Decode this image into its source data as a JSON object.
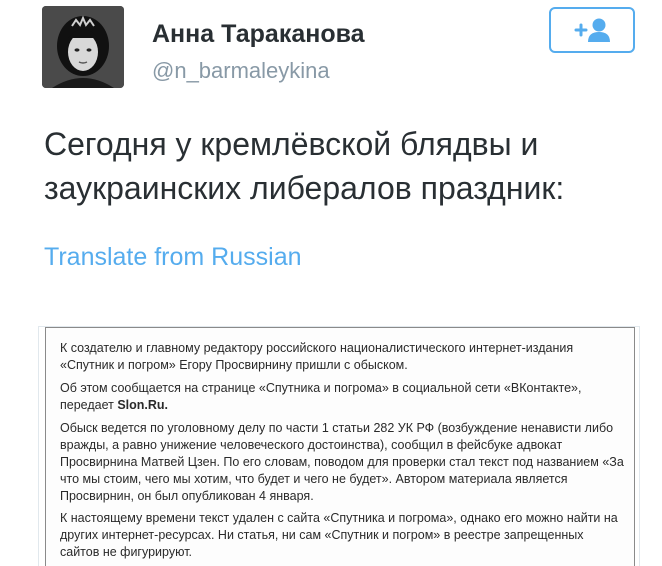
{
  "header": {
    "display_name": "Анна Тараканова",
    "handle": "@n_barmaleykina",
    "follow_icon": "add-user-icon"
  },
  "tweet": {
    "text": "Сегодня у кремлёвской блядвы и заукраинских либералов праздник:",
    "translate_label": "Translate from Russian"
  },
  "attached_image": {
    "paragraphs": [
      "К создателю и главному редактору российского националистического интернет-издания «Спутник и погром» Егору Просвирнину пришли с обыском.",
      "Об этом сообщается на странице «Спутника и погрома» в социальной сети «ВКонтакте», передает",
      "Обыск ведется по уголовному делу по части 1 статьи 282 УК РФ (возбуждение ненависти либо вражды, а равно унижение человеческого достоинства), сообщил в фейсбуке адвокат Просвирнина Матвей Цзен. По его словам, поводом для проверки стал текст под названием «За что мы стоим, чего мы хотим, что будет и чего не будет». Автором материала является Просвирнин, он был опубликован 4 января.",
      "К настоящему времени текст удален с сайта «Спутника и погрома», однако его можно найти на других интернет-ресурсах. Ни статья, ни сам «Спутник и погром» в реестре запрещенных сайтов не фигурируют."
    ],
    "source_link": "Slon.Ru."
  },
  "colors": {
    "accent": "#55acee",
    "text": "#292f33",
    "muted": "#8899a6"
  }
}
